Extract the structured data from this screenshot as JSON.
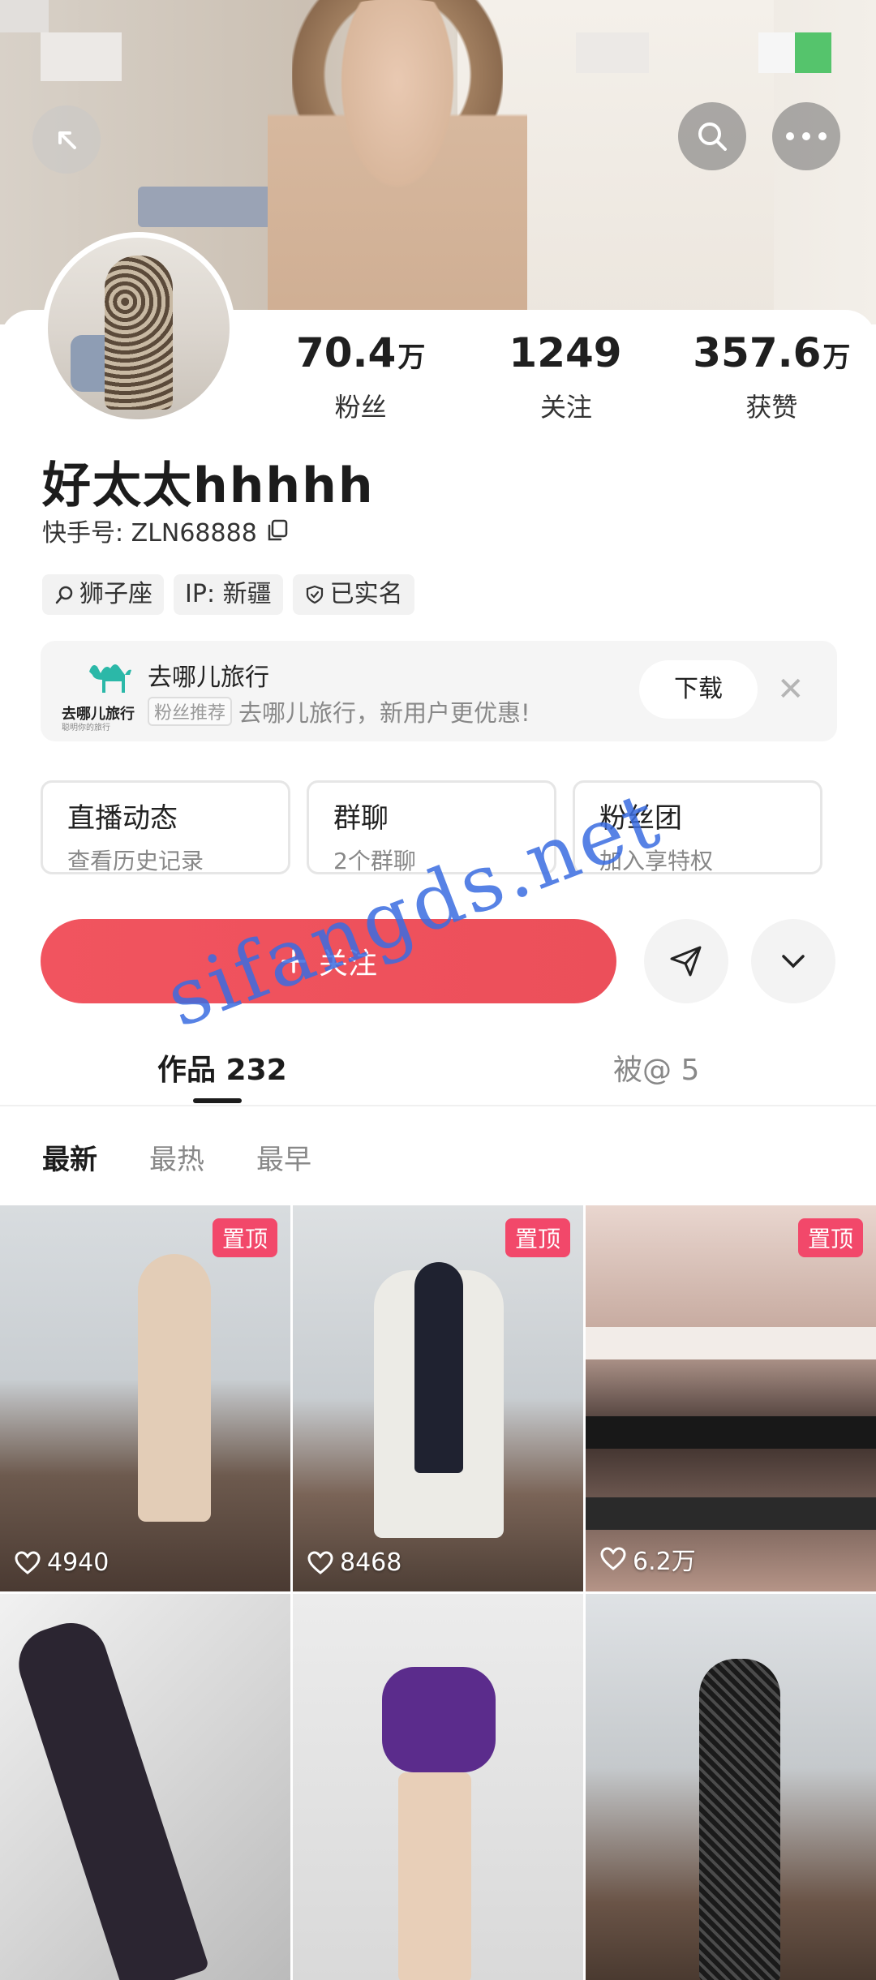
{
  "profile": {
    "name": "好太太hhhhh",
    "kuaishou_id_label": "快手号: ZLN68888",
    "stats": [
      {
        "value": "70.4",
        "unit": "万",
        "label": "粉丝"
      },
      {
        "value": "1249",
        "unit": "",
        "label": "关注"
      },
      {
        "value": "357.6",
        "unit": "万",
        "label": "获赞"
      }
    ],
    "tags": [
      "狮子座",
      "IP: 新疆",
      "已实名"
    ]
  },
  "ad": {
    "logo_text": "去哪儿旅行",
    "logo_subtext": "聪明你的旅行",
    "title": "去哪儿旅行",
    "badge": "粉丝推荐",
    "description": "去哪儿旅行，新用户更优惠!",
    "download_label": "下载",
    "close_label": "✕"
  },
  "entries": [
    {
      "title": "直播动态",
      "subtitle": "查看历史记录"
    },
    {
      "title": "群聊",
      "subtitle": "2个群聊"
    },
    {
      "title": "粉丝团",
      "subtitle": "加入享特权"
    }
  ],
  "actions": {
    "follow_label": "关注"
  },
  "tabs": [
    {
      "label": "作品 232",
      "active": true
    },
    {
      "label": "被@ 5",
      "active": false
    }
  ],
  "sort": [
    "最新",
    "最热",
    "最早"
  ],
  "posts": [
    {
      "pinned_label": "置顶",
      "likes": "4940"
    },
    {
      "pinned_label": "置顶",
      "likes": "8468"
    },
    {
      "pinned_label": "置顶",
      "likes": "6.2万"
    },
    {
      "pinned_label": "",
      "likes": ""
    },
    {
      "pinned_label": "",
      "likes": ""
    },
    {
      "pinned_label": "",
      "likes": ""
    }
  ],
  "watermark": "sifangds.net",
  "colors": {
    "accent": "#f1545f",
    "pin": "#f2486a",
    "watermark": "#3a6ce0"
  }
}
